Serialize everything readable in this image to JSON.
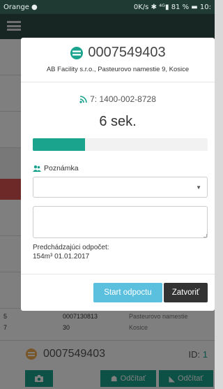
{
  "status_bar": {
    "carrier": "Orange",
    "right": "0K/s ✱ ⁴ᴳ▮ 81 % ▬ 10:"
  },
  "modal": {
    "meter_number": "0007549403",
    "address": "AB Facility s.r.o., Pasteurovo namestie 9, Kosice",
    "register": "7: 1400-002-8728",
    "countdown": "6 sek.",
    "progress_fraction": 0.3,
    "note_label": "Poznámka",
    "select_value": "",
    "note_text": "",
    "previous_label": "Predchádzajúci odpočet:",
    "previous_value": "154m³ 01.01.2017",
    "start_label": "Start odpoctu",
    "close_label": "Zatvoriť"
  },
  "background": {
    "row": {
      "col1": "5",
      "col1b": "7",
      "col2": "0007130813",
      "col2b": "30",
      "col3": "Pasteurovo namestie",
      "col3b": "Kosice"
    },
    "meter_number": "0007549403",
    "id_label": "ID:",
    "id_value": "1",
    "read_label_1": "Odčítať",
    "read_label_2": "Odčítať"
  },
  "colors": {
    "accent_teal": "#1aa38d",
    "info_blue": "#5bc0de",
    "dark": "#333333",
    "danger": "#d9534f"
  },
  "icons": {
    "meter": "gas-meter-icon",
    "register": "rss-icon",
    "note": "group-icon",
    "camera": "camera-icon"
  }
}
